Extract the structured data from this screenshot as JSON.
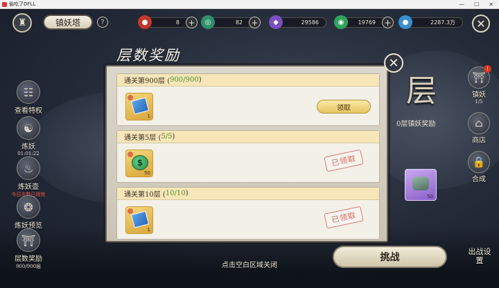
{
  "window": {
    "title": "偷吃了DFLL"
  },
  "header": {
    "stage_title": "镇妖塔",
    "help_label": "?"
  },
  "resources": [
    {
      "icon": "red-pill-icon",
      "value": "8",
      "color": "#c0392b"
    },
    {
      "icon": "green-swirl-icon",
      "value": "82",
      "color": "#2f8f6a"
    },
    {
      "icon": "purple-crystal-icon",
      "value": "29586",
      "color": "#7b4fc0"
    },
    {
      "icon": "jade-coin-icon",
      "value": "19769",
      "color": "#2fa35c"
    },
    {
      "icon": "blue-orb-icon",
      "value": "2287.3万",
      "color": "#3a8fd0"
    }
  ],
  "left_menu": [
    {
      "label": "查看特权",
      "sub": ""
    },
    {
      "label": "炼妖",
      "sub": "01:01:22"
    },
    {
      "label": "炼妖壶",
      "sub": "今日次数已用完"
    },
    {
      "label": "炼妖预览",
      "sub": ""
    },
    {
      "label": "层数奖励",
      "sub": "900/900层"
    }
  ],
  "right_menu": [
    {
      "label": "镇妖",
      "sub": "1/5",
      "badge": "!"
    },
    {
      "label": "商店",
      "sub": ""
    },
    {
      "label": "合成",
      "sub": ""
    }
  ],
  "background": {
    "big_char": "层",
    "side_reward_text": "0层镇妖奖励",
    "side_item_count": "50",
    "battle_label": "挑战",
    "settings_label": "出战设置"
  },
  "panel": {
    "title": "层数奖励",
    "close_hint": "点击空白区域关闭",
    "rows": [
      {
        "prefix": "通关第900层 (",
        "progress": "900/900",
        "suffix": ")",
        "item_count": "1",
        "claim_label": "领取",
        "claimed_label": ""
      },
      {
        "prefix": "通关第5层 (",
        "progress": "5/5",
        "suffix": ")",
        "item_count": "50",
        "claim_label": "",
        "claimed_label": "已领取"
      },
      {
        "prefix": "通关第10层 (",
        "progress": "10/10",
        "suffix": ")",
        "item_count": "1",
        "claim_label": "",
        "claimed_label": "已领取"
      }
    ]
  }
}
